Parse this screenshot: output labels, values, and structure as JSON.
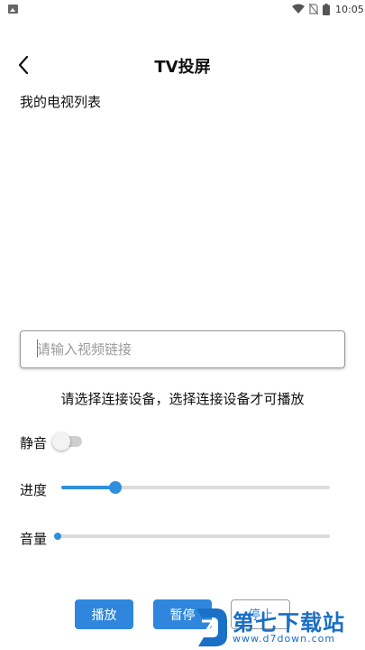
{
  "status_bar": {
    "time": "10:05"
  },
  "header": {
    "title": "TV投屏"
  },
  "tv_list": {
    "title": "我的电视列表"
  },
  "url_input": {
    "placeholder": "请输入视频链接",
    "value": ""
  },
  "device_hint": "请选择连接设备，选择连接设备才可播放",
  "mute": {
    "label": "静音",
    "on": false
  },
  "progress": {
    "label": "进度",
    "value": 0.2
  },
  "volume": {
    "label": "音量",
    "value": 0.0
  },
  "buttons": {
    "play": "播放",
    "pause": "暂停",
    "stop": "停止"
  },
  "watermark": {
    "name": "第七下载站",
    "url": "www.d7down.com"
  },
  "colors": {
    "accent": "#2f86dc"
  }
}
